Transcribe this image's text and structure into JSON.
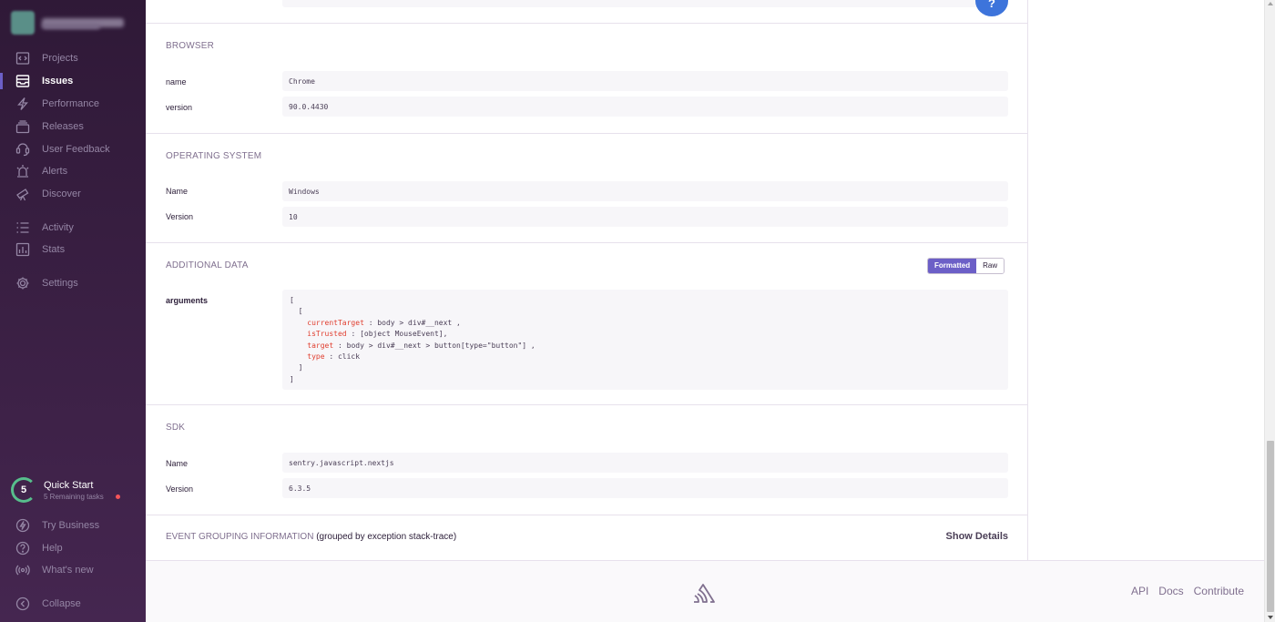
{
  "sidebar": {
    "nav": [
      {
        "label": "Projects",
        "icon": "projects-icon"
      },
      {
        "label": "Issues",
        "icon": "issues-icon",
        "active": true
      },
      {
        "label": "Performance",
        "icon": "lightning-icon"
      },
      {
        "label": "Releases",
        "icon": "releases-icon"
      },
      {
        "label": "User Feedback",
        "icon": "feedback-icon"
      },
      {
        "label": "Alerts",
        "icon": "siren-icon"
      },
      {
        "label": "Discover",
        "icon": "telescope-icon"
      },
      {
        "label": "Activity",
        "icon": "list-icon"
      },
      {
        "label": "Stats",
        "icon": "bar-chart-icon"
      },
      {
        "label": "Settings",
        "icon": "gear-icon"
      }
    ],
    "quick_start": {
      "count": "5",
      "title": "Quick Start",
      "subtitle": "5 Remaining tasks"
    },
    "bottom": [
      {
        "label": "Try Business",
        "icon": "business-icon"
      },
      {
        "label": "Help",
        "icon": "question-icon"
      },
      {
        "label": "What's new",
        "icon": "broadcast-icon"
      },
      {
        "label": "Collapse",
        "icon": "collapse-icon"
      }
    ]
  },
  "main": {
    "help_button": "?",
    "browser": {
      "title": "BROWSER",
      "rows": [
        {
          "key": "name",
          "value": "Chrome"
        },
        {
          "key": "version",
          "value": "90.0.4430"
        }
      ]
    },
    "os": {
      "title": "OPERATING SYSTEM",
      "rows": [
        {
          "key": "Name",
          "value": "Windows"
        },
        {
          "key": "Version",
          "value": "10"
        }
      ]
    },
    "additional": {
      "title": "ADDITIONAL DATA",
      "toggle_formatted": "Formatted",
      "toggle_raw": "Raw",
      "key": "arguments",
      "code": {
        "open_bracket": "[",
        "open_brace": "  [",
        "lines": [
          {
            "k": "currentTarget",
            "v": " : body > div#__next ,"
          },
          {
            "k": "isTrusted",
            "v": " : [object MouseEvent],"
          },
          {
            "k": "target",
            "v": " : body > div#__next > button[type=\"button\"] ,"
          },
          {
            "k": "type",
            "v": " : click"
          }
        ],
        "close_brace": "  ]",
        "close_bracket": "]"
      }
    },
    "sdk": {
      "title": "SDK",
      "rows": [
        {
          "key": "Name",
          "value": "sentry.javascript.nextjs"
        },
        {
          "key": "Version",
          "value": "6.3.5"
        }
      ]
    },
    "grouping": {
      "title": "EVENT GROUPING INFORMATION",
      "note": "(grouped by exception stack-trace)",
      "action": "Show Details"
    }
  },
  "footer": {
    "links": [
      "API",
      "Docs",
      "Contribute"
    ]
  },
  "colors": {
    "accent": "#6c5fc7",
    "help": "#3d74db",
    "sidebar_top": "#2f1937",
    "sidebar_bottom": "#452650",
    "code_key": "#e03e2f"
  }
}
